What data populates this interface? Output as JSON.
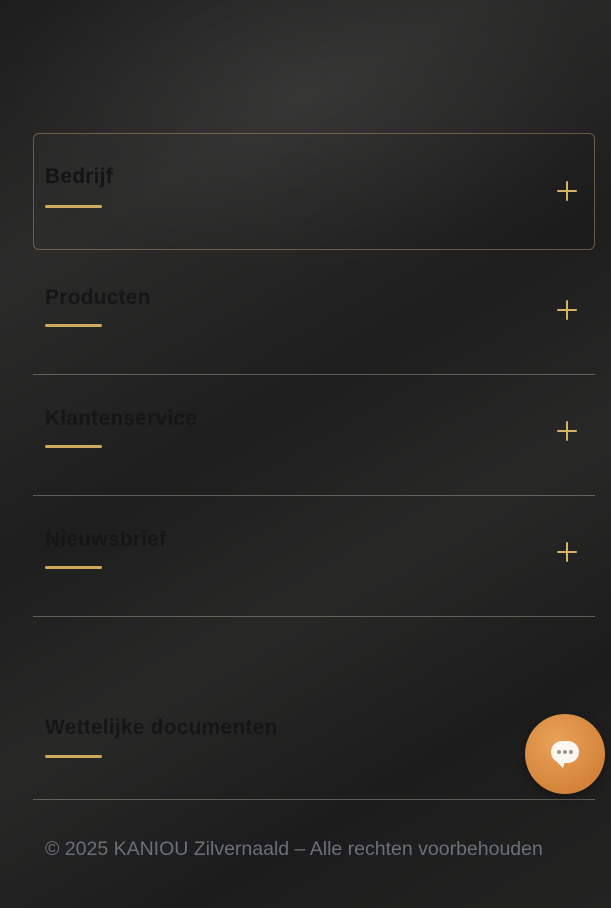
{
  "accordion": {
    "items": [
      {
        "title": "Bedrijf",
        "expanded_indicator": "+"
      },
      {
        "title": "Producten",
        "expanded_indicator": "+"
      },
      {
        "title": "Klantenservice",
        "expanded_indicator": "+"
      },
      {
        "title": "Nieuwsbrief",
        "expanded_indicator": "+"
      }
    ]
  },
  "legal": {
    "title": "Wettelijke documenten"
  },
  "footer": {
    "copyright": "© 2025 KANIOU Zilvernaald – Alle rechten voorbehouden"
  },
  "chat": {
    "icon": "chat-bubble-icon"
  },
  "colors": {
    "accent_gold": "#cfaa5c",
    "chat_orange": "#d98a3f",
    "background": "#222222",
    "copyright_text": "#6b7078"
  }
}
